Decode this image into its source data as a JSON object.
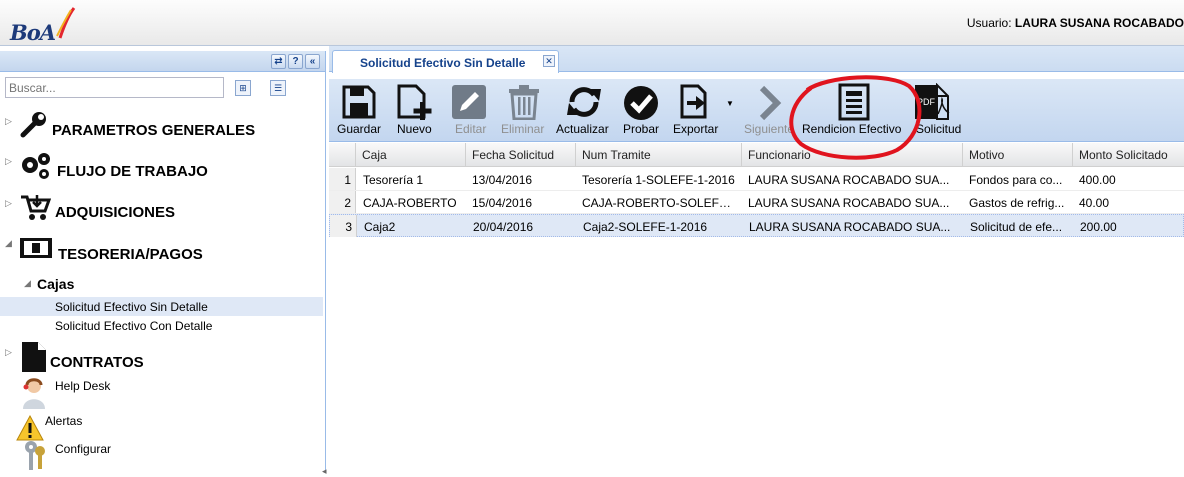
{
  "app": {
    "logo_text": "BoA",
    "user_label": "Usuario:",
    "user_name": "LAURA SUSANA ROCABADO"
  },
  "sidebar": {
    "search_placeholder": "Buscar...",
    "tools": [
      "⇄",
      "?",
      "«"
    ],
    "items": [
      {
        "label": "PARAMETROS GENERALES",
        "icon": "wrench-icon",
        "expanded": false
      },
      {
        "label": "FLUJO DE TRABAJO",
        "icon": "gears-icon",
        "expanded": false
      },
      {
        "label": "ADQUISICIONES",
        "icon": "cart-icon",
        "expanded": false
      },
      {
        "label": "TESORERIA/PAGOS",
        "icon": "money-icon",
        "expanded": true
      },
      {
        "label": "CONTRATOS",
        "icon": "document-icon",
        "expanded": false
      }
    ],
    "cajas_label": "Cajas",
    "cajas_children": [
      "Solicitud Efectivo Sin Detalle",
      "Solicitud Efectivo Con Detalle"
    ],
    "extras": [
      {
        "label": "Help Desk",
        "icon": "help-desk-icon"
      },
      {
        "label": "Alertas",
        "icon": "warning-icon"
      },
      {
        "label": "Configurar",
        "icon": "keys-icon"
      }
    ]
  },
  "tab": {
    "label": "Solicitud Efectivo Sin Detalle",
    "close": "✕"
  },
  "toolbar": {
    "buttons": [
      {
        "label": "Guardar",
        "icon": "save-icon",
        "enabled": true
      },
      {
        "label": "Nuevo",
        "icon": "new-icon",
        "enabled": true
      },
      {
        "label": "Editar",
        "icon": "edit-icon",
        "enabled": false
      },
      {
        "label": "Eliminar",
        "icon": "trash-icon",
        "enabled": false
      },
      {
        "label": "Actualizar",
        "icon": "refresh-icon",
        "enabled": true
      },
      {
        "label": "Probar",
        "icon": "check-icon",
        "enabled": true
      },
      {
        "label": "Exportar",
        "icon": "export-icon",
        "enabled": true
      },
      {
        "label": "Siguiente",
        "icon": "chevron-right-icon",
        "enabled": false
      },
      {
        "label": "Rendicion Efectivo",
        "icon": "form-icon",
        "enabled": true
      },
      {
        "label": "Solicitud",
        "icon": "pdf-icon",
        "enabled": true
      }
    ],
    "pdf_badge": "PDF"
  },
  "grid": {
    "columns": [
      "Caja",
      "Fecha Solicitud",
      "Num Tramite",
      "Funcionario",
      "Motivo",
      "Monto Solicitado"
    ],
    "rows": [
      {
        "num": "1",
        "cells": [
          "Tesorería 1",
          "13/04/2016",
          "Tesorería 1-SOLEFE-1-2016",
          "LAURA SUSANA ROCABADO SUA...",
          "Fondos para co...",
          "400.00"
        ]
      },
      {
        "num": "2",
        "cells": [
          "CAJA-ROBERTO",
          "15/04/2016",
          "CAJA-ROBERTO-SOLEFE...",
          "LAURA SUSANA ROCABADO SUA...",
          "Gastos de refrig...",
          "40.00"
        ]
      },
      {
        "num": "3",
        "cells": [
          "Caja2",
          "20/04/2016",
          "Caja2-SOLEFE-1-2016",
          "LAURA SUSANA ROCABADO SUA...",
          "Solicitud de efe...",
          "200.00"
        ],
        "selected": true
      }
    ]
  },
  "colors": {
    "accent": "#15428b",
    "selection": "#dfe8f6",
    "annotation": "#e0141e"
  }
}
